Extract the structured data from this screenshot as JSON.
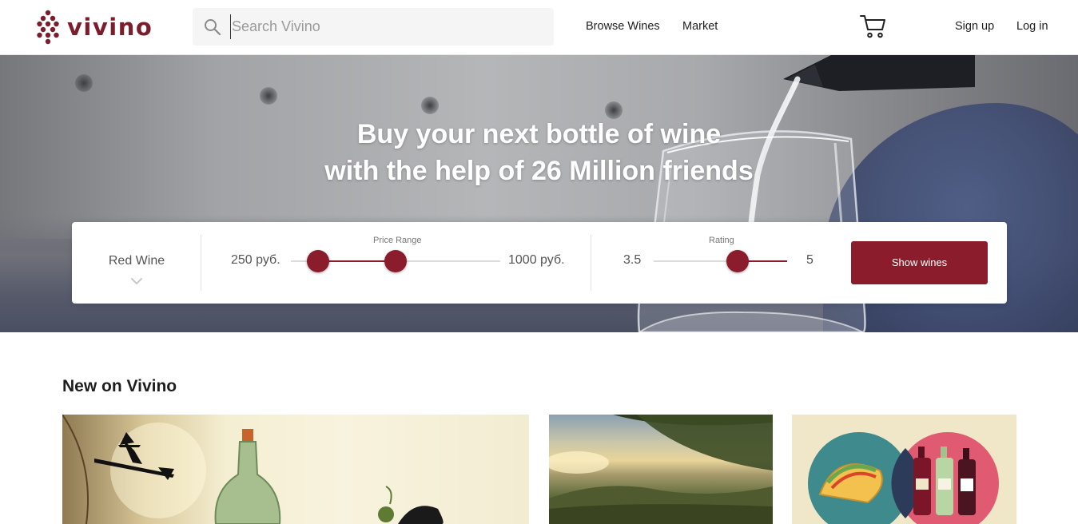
{
  "header": {
    "logo_text": "vivino",
    "search_placeholder": "Search Vivino",
    "nav": [
      {
        "label": "Browse Wines"
      },
      {
        "label": "Market"
      }
    ],
    "sign_up": "Sign up",
    "log_in": "Log in"
  },
  "hero": {
    "title_line1": "Buy your next bottle of wine",
    "title_line2": "with the help of 26 Million friends"
  },
  "filter": {
    "wine_type": "Red Wine",
    "price": {
      "label": "Price Range",
      "min_label": "250 руб.",
      "max_label": "1000 руб.",
      "low_fraction": 0.13,
      "high_fraction": 0.5
    },
    "rating": {
      "label": "Rating",
      "min_label": "3.5",
      "max_label": "5",
      "value_fraction": 0.63
    },
    "show_button": "Show wines"
  },
  "section": {
    "title": "New on Vivino"
  },
  "colors": {
    "brand": "#7c1d2c",
    "accent": "#8a1c2b"
  }
}
